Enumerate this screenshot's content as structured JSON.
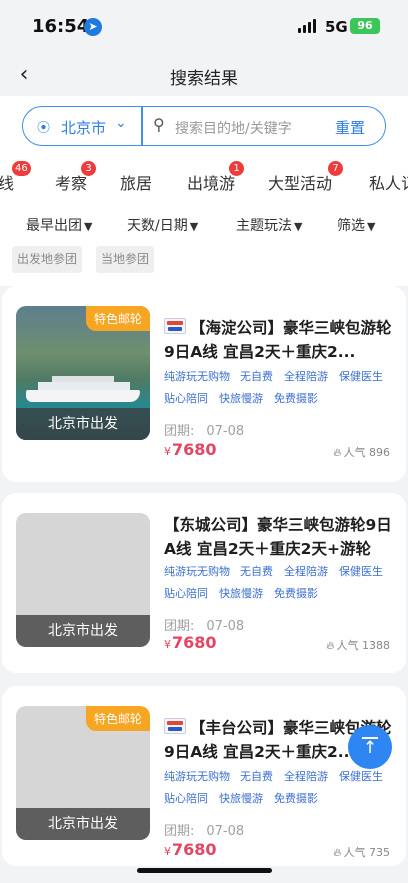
{
  "status": {
    "time": "16:54",
    "network": "5G",
    "battery": "96"
  },
  "nav": {
    "title": "搜索结果",
    "back_icon": "chevron-left-icon"
  },
  "search": {
    "city": "北京市",
    "placeholder": "搜索目的地/关键字",
    "reset": "重置"
  },
  "tabs": [
    {
      "label": "线",
      "badge": "46"
    },
    {
      "label": "考察",
      "badge": "3"
    },
    {
      "label": "旅居",
      "badge": ""
    },
    {
      "label": "出境游",
      "badge": "1"
    },
    {
      "label": "大型活动",
      "badge": "7"
    },
    {
      "label": "私人订",
      "badge": ""
    }
  ],
  "filters": [
    "最早出团",
    "天数/日期",
    "主题玩法",
    "筛选"
  ],
  "chips": [
    "出发地参团",
    "当地参团"
  ],
  "labels": {
    "date_label": "团期:",
    "currency": "¥",
    "popularity": "人气"
  },
  "products": [
    {
      "tag": "特色邮轮",
      "depart": "北京市出发",
      "title": "【海淀公司】豪华三峡包游轮9日A线 宜昌2天＋重庆2...",
      "tags": [
        "纯游玩无购物",
        "无自费",
        "全程陪游",
        "保健医生",
        "贴心陪同",
        "快旅慢游",
        "免费摄影"
      ],
      "date": "07-08",
      "price": "7680",
      "popularity": "896"
    },
    {
      "tag": "",
      "depart": "北京市出发",
      "title": "【东城公司】豪华三峡包游轮9日A线 宜昌2天＋重庆2天+游轮",
      "tags": [
        "纯游玩无购物",
        "无自费",
        "全程陪游",
        "保健医生",
        "贴心陪同",
        "快旅慢游",
        "免费摄影"
      ],
      "date": "07-08",
      "price": "7680",
      "popularity": "1388"
    },
    {
      "tag": "特色邮轮",
      "depart": "北京市出发",
      "title": "【丰台公司】豪华三峡包游轮9日A线 宜昌2天＋重庆2...",
      "tags": [
        "纯游玩无购物",
        "无自费",
        "全程陪游",
        "保健医生",
        "贴心陪同",
        "快旅慢游",
        "免费摄影"
      ],
      "date": "07-08",
      "price": "7680",
      "popularity": "735"
    }
  ],
  "colors": {
    "accent": "#2f7de1",
    "price": "#e34562",
    "tag_bg": "#f6a623",
    "badge": "#ef3b3b"
  }
}
